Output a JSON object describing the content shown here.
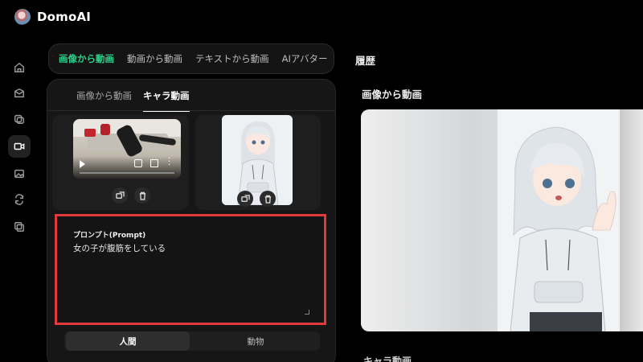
{
  "app": {
    "name": "DomoAI"
  },
  "sidebar": {
    "items": [
      {
        "icon": "home-icon"
      },
      {
        "icon": "inbox-icon"
      },
      {
        "icon": "layers-icon"
      },
      {
        "icon": "video-icon",
        "active": true
      },
      {
        "icon": "image-icon"
      },
      {
        "icon": "refresh-icon"
      },
      {
        "icon": "copy-icon"
      }
    ]
  },
  "main_tabs": [
    {
      "label": "画像から動画",
      "active": true
    },
    {
      "label": "動画から動画"
    },
    {
      "label": "テキストから動画"
    },
    {
      "label": "AIアバター"
    }
  ],
  "sub_tabs": [
    {
      "label": "画像から動画"
    },
    {
      "label": "キャラ動画",
      "active": true
    }
  ],
  "prompt": {
    "label": "プロンプト(Prompt)",
    "value": "女の子が腹筋をしている"
  },
  "mode": {
    "options": [
      "人間",
      "動物"
    ],
    "selected": "人間"
  },
  "history": {
    "title": "履歴",
    "section_title": "画像から動画",
    "next_section_title": "キャラ動画"
  },
  "colors": {
    "accent": "#2fd08c",
    "highlight_border": "#e23a3a"
  }
}
